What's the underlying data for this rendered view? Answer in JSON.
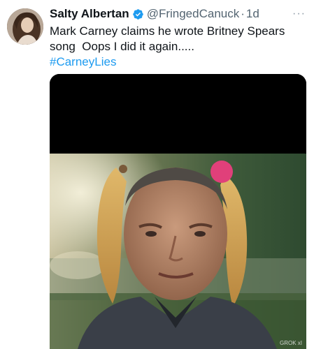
{
  "tweet": {
    "author_name": "Salty Albertan",
    "handle": "@FringedCanuck",
    "separator": "·",
    "time": "1d",
    "more_label": "···",
    "text_line_1": "Mark Carney claims he wrote Britney Spears",
    "text_line_2": "song  Oops I did it again.....",
    "hashtag": "#CarneyLies",
    "image_watermark": "GROK xI"
  },
  "icons": {
    "verified": "verified-badge-icon",
    "more": "more-options-icon"
  },
  "colors": {
    "link": "#1d9bf0",
    "secondary_text": "#536471",
    "verified": "#1d9bf0"
  }
}
